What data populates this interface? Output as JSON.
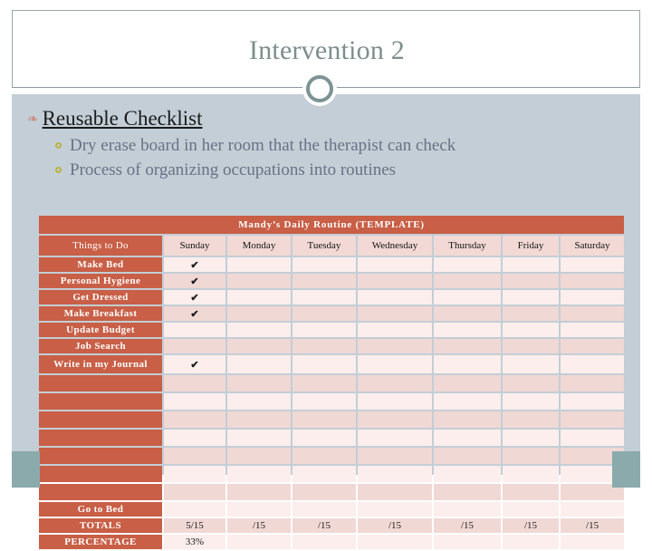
{
  "slide": {
    "title": "Intervention 2",
    "accent_color": "#8aaaab",
    "band_color": "#c3ced6",
    "title_color": "#7d8e8e"
  },
  "bullets": [
    {
      "level": 1,
      "glyph": "bullet-ornament-icon",
      "glyph_char": "❧",
      "text": "Reusable Checklist"
    },
    {
      "level": 2,
      "glyph": "bullet-circle-icon",
      "text": "Dry erase board in her room that the therapist can check"
    },
    {
      "level": 2,
      "glyph": "bullet-circle-icon",
      "text": "Process of organizing occupations into routines"
    }
  ],
  "table": {
    "caption": "Mandy’s Daily Routine (TEMPLATE)",
    "accent_color": "#c85f46",
    "row_label_header": "Things to Do",
    "columns": [
      "Sunday",
      "Monday",
      "Tuesday",
      "Wednesday",
      "Thursday",
      "Friday",
      "Saturday"
    ],
    "check_char": "✔",
    "rows": [
      {
        "label": "Make Bed",
        "cells": [
          "✔",
          "",
          "",
          "",
          "",
          "",
          ""
        ]
      },
      {
        "label": "Personal Hygiene",
        "cells": [
          "✔",
          "",
          "",
          "",
          "",
          "",
          ""
        ]
      },
      {
        "label": "Get Dressed",
        "cells": [
          "✔",
          "",
          "",
          "",
          "",
          "",
          ""
        ]
      },
      {
        "label": "Make Breakfast",
        "cells": [
          "✔",
          "",
          "",
          "",
          "",
          "",
          ""
        ]
      },
      {
        "label": "Update Budget",
        "cells": [
          "",
          "",
          "",
          "",
          "",
          "",
          ""
        ]
      },
      {
        "label": "Job Search",
        "cells": [
          "",
          "",
          "",
          "",
          "",
          "",
          ""
        ]
      },
      {
        "label": "Write in my Journal",
        "cells": [
          "✔",
          "",
          "",
          "",
          "",
          "",
          ""
        ]
      },
      {
        "label": "",
        "cells": [
          "",
          "",
          "",
          "",
          "",
          "",
          ""
        ]
      },
      {
        "label": "",
        "cells": [
          "",
          "",
          "",
          "",
          "",
          "",
          ""
        ]
      },
      {
        "label": "",
        "cells": [
          "",
          "",
          "",
          "",
          "",
          "",
          ""
        ]
      },
      {
        "label": "",
        "cells": [
          "",
          "",
          "",
          "",
          "",
          "",
          ""
        ]
      },
      {
        "label": "",
        "cells": [
          "",
          "",
          "",
          "",
          "",
          "",
          ""
        ]
      },
      {
        "label": "",
        "cells": [
          "",
          "",
          "",
          "",
          "",
          "",
          ""
        ]
      },
      {
        "label": "",
        "cells": [
          "",
          "",
          "",
          "",
          "",
          "",
          ""
        ]
      },
      {
        "label": "Go to Bed",
        "cells": [
          "",
          "",
          "",
          "",
          "",
          "",
          ""
        ]
      },
      {
        "label": "TOTALS",
        "cells": [
          "5/15",
          "/15",
          "/15",
          "/15",
          "/15",
          "/15",
          "/15"
        ]
      },
      {
        "label": "PERCENTAGE",
        "cells": [
          "33%",
          "",
          "",
          "",
          "",
          "",
          ""
        ]
      }
    ]
  }
}
